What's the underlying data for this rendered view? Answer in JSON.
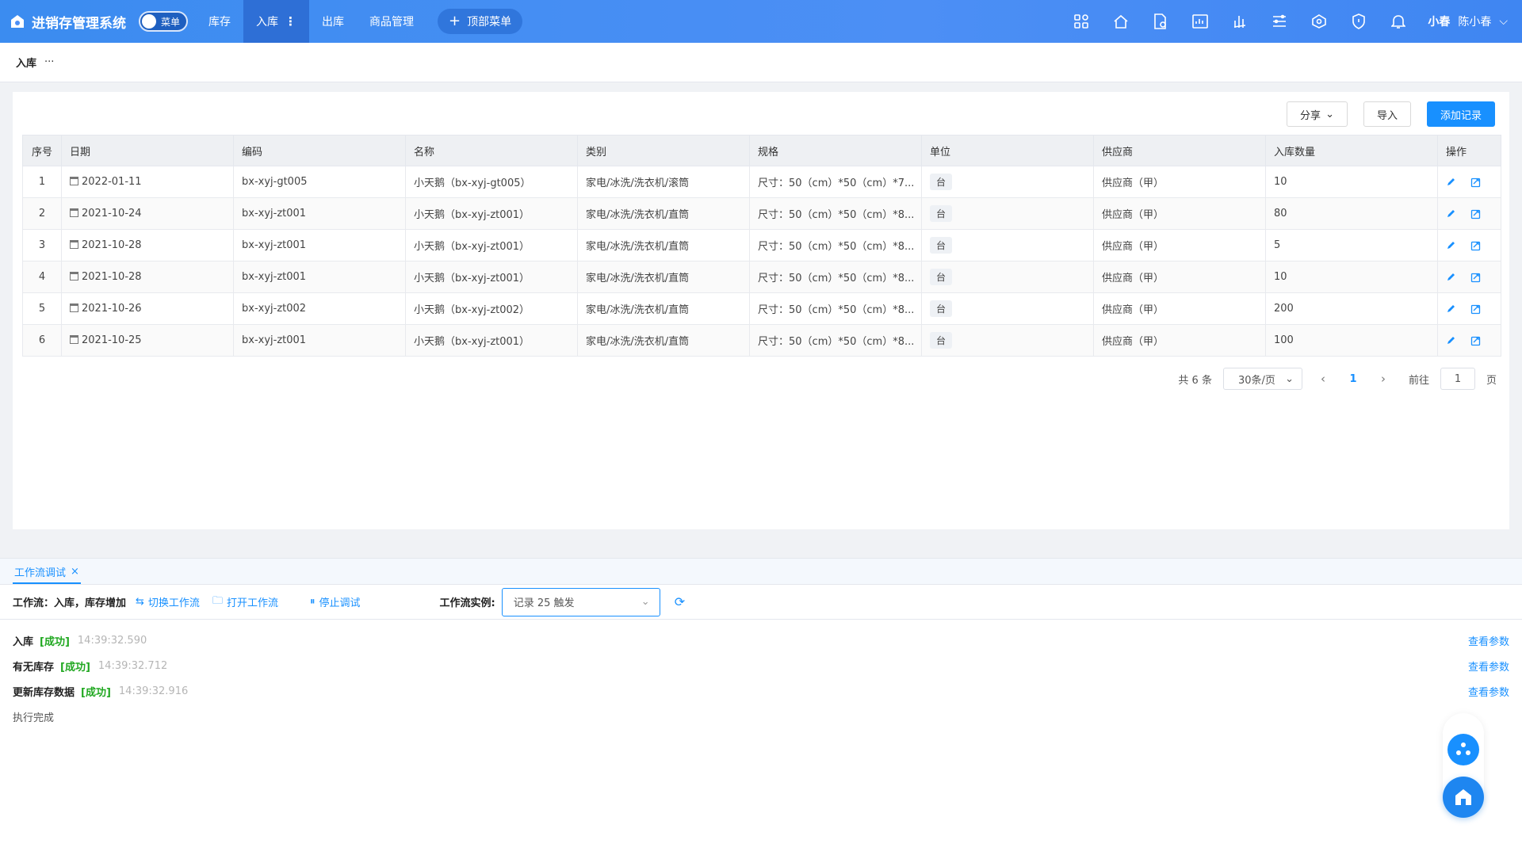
{
  "app": {
    "title": "进销存管理系统",
    "menu_toggle_label": "菜单"
  },
  "nav": {
    "items": [
      {
        "label": "库存",
        "active": false
      },
      {
        "label": "入库",
        "active": true
      },
      {
        "label": "出库",
        "active": false
      },
      {
        "label": "商品管理",
        "active": false
      }
    ],
    "top_menu_label": "顶部菜单"
  },
  "top_icons": [
    "apps-icon",
    "home-icon",
    "document-settings-icon",
    "report-icon",
    "chart-icon",
    "flow-icon",
    "network-icon",
    "shield-icon",
    "bell-icon"
  ],
  "user": {
    "nickname": "小春",
    "name": "陈小春"
  },
  "breadcrumb": {
    "current": "入库",
    "more": "···"
  },
  "toolbar": {
    "share_label": "分享",
    "import_label": "导入",
    "add_label": "添加记录"
  },
  "table": {
    "headers": [
      "序号",
      "日期",
      "编码",
      "名称",
      "类别",
      "规格",
      "单位",
      "供应商",
      "入库数量",
      "操作"
    ],
    "rows": [
      {
        "idx": "1",
        "date": "2022-01-11",
        "code": "bx-xyj-gt005",
        "name": "小天鹅（bx-xyj-gt005）",
        "category": "家电/冰洗/洗衣机/滚筒",
        "spec": "尺寸：50（cm）*50（cm）*7...",
        "unit": "台",
        "supplier": "供应商（甲）",
        "qty": "10"
      },
      {
        "idx": "2",
        "date": "2021-10-24",
        "code": "bx-xyj-zt001",
        "name": "小天鹅（bx-xyj-zt001）",
        "category": "家电/冰洗/洗衣机/直筒",
        "spec": "尺寸：50（cm）*50（cm）*8...",
        "unit": "台",
        "supplier": "供应商（甲）",
        "qty": "80"
      },
      {
        "idx": "3",
        "date": "2021-10-28",
        "code": "bx-xyj-zt001",
        "name": "小天鹅（bx-xyj-zt001）",
        "category": "家电/冰洗/洗衣机/直筒",
        "spec": "尺寸：50（cm）*50（cm）*8...",
        "unit": "台",
        "supplier": "供应商（甲）",
        "qty": "5"
      },
      {
        "idx": "4",
        "date": "2021-10-28",
        "code": "bx-xyj-zt001",
        "name": "小天鹅（bx-xyj-zt001）",
        "category": "家电/冰洗/洗衣机/直筒",
        "spec": "尺寸：50（cm）*50（cm）*8...",
        "unit": "台",
        "supplier": "供应商（甲）",
        "qty": "10"
      },
      {
        "idx": "5",
        "date": "2021-10-26",
        "code": "bx-xyj-zt002",
        "name": "小天鹅（bx-xyj-zt002）",
        "category": "家电/冰洗/洗衣机/直筒",
        "spec": "尺寸：50（cm）*50（cm）*8...",
        "unit": "台",
        "supplier": "供应商（甲）",
        "qty": "200"
      },
      {
        "idx": "6",
        "date": "2021-10-25",
        "code": "bx-xyj-zt001",
        "name": "小天鹅（bx-xyj-zt001）",
        "category": "家电/冰洗/洗衣机/直筒",
        "spec": "尺寸：50（cm）*50（cm）*8...",
        "unit": "台",
        "supplier": "供应商（甲）",
        "qty": "100"
      }
    ]
  },
  "pager": {
    "total": "共 6 条",
    "page_size": "30条/页",
    "current": "1",
    "goto_label": "前往",
    "goto_value": "1",
    "page_suffix": "页"
  },
  "debug": {
    "tab_label": "工作流调试",
    "workflow_label": "工作流：入库，库存增加",
    "switch_label": "切换工作流",
    "open_label": "打开工作流",
    "stop_label": "停止调试",
    "instance_label": "工作流实例:",
    "instance_value": "记录 25 触发",
    "logs": [
      {
        "step": "入库",
        "status": "[成功]",
        "time": "14:39:32.590",
        "link": "查看参数"
      },
      {
        "step": "有无库存",
        "status": "[成功]",
        "time": "14:39:32.712",
        "link": "查看参数"
      },
      {
        "step": "更新库存数据",
        "status": "[成功]",
        "time": "14:39:32.916",
        "link": "查看参数"
      }
    ],
    "done_label": "执行完成"
  },
  "colors": {
    "accent": "#1890ff",
    "topbar": "#4c8ff5",
    "success": "#21a821"
  }
}
